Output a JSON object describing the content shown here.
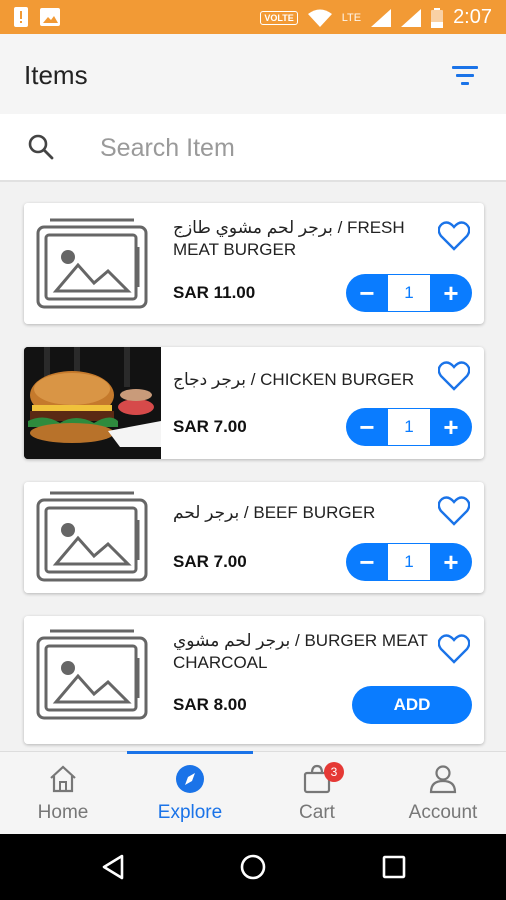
{
  "status_bar": {
    "volte": "VOLTE",
    "network": "LTE",
    "time": "2:07"
  },
  "header": {
    "title": "Items"
  },
  "search": {
    "placeholder": "Search Item"
  },
  "items": [
    {
      "name": "برجر لحم مشوي طازج / FRESH MEAT BURGER",
      "price": "SAR 11.00",
      "image": "placeholder-image-icon",
      "quantity": "1",
      "control": "stepper"
    },
    {
      "name": "برجر دجاج / CHICKEN BURGER",
      "price": "SAR 7.00",
      "image": "burger-photo",
      "quantity": "1",
      "control": "stepper"
    },
    {
      "name": "برجر لحم / BEEF BURGER",
      "price": "SAR 7.00",
      "image": "placeholder-image-icon",
      "quantity": "1",
      "control": "stepper"
    },
    {
      "name": "برجر لحم مشوي / BURGER MEAT CHARCOAL",
      "price": "SAR 8.00",
      "image": "placeholder-image-icon",
      "add_label": "ADD",
      "control": "add"
    }
  ],
  "stepper": {
    "minus": "−",
    "plus": "+"
  },
  "bottom_nav": {
    "items": [
      {
        "label": "Home",
        "icon": "home-icon"
      },
      {
        "label": "Explore",
        "icon": "compass-icon",
        "active": true
      },
      {
        "label": "Cart",
        "icon": "cart-icon",
        "badge": "3"
      },
      {
        "label": "Account",
        "icon": "person-icon"
      }
    ]
  },
  "colors": {
    "accent": "#0a7cff",
    "nav_active": "#1a73e8",
    "status_bar": "#f29a35",
    "badge": "#e53935"
  }
}
